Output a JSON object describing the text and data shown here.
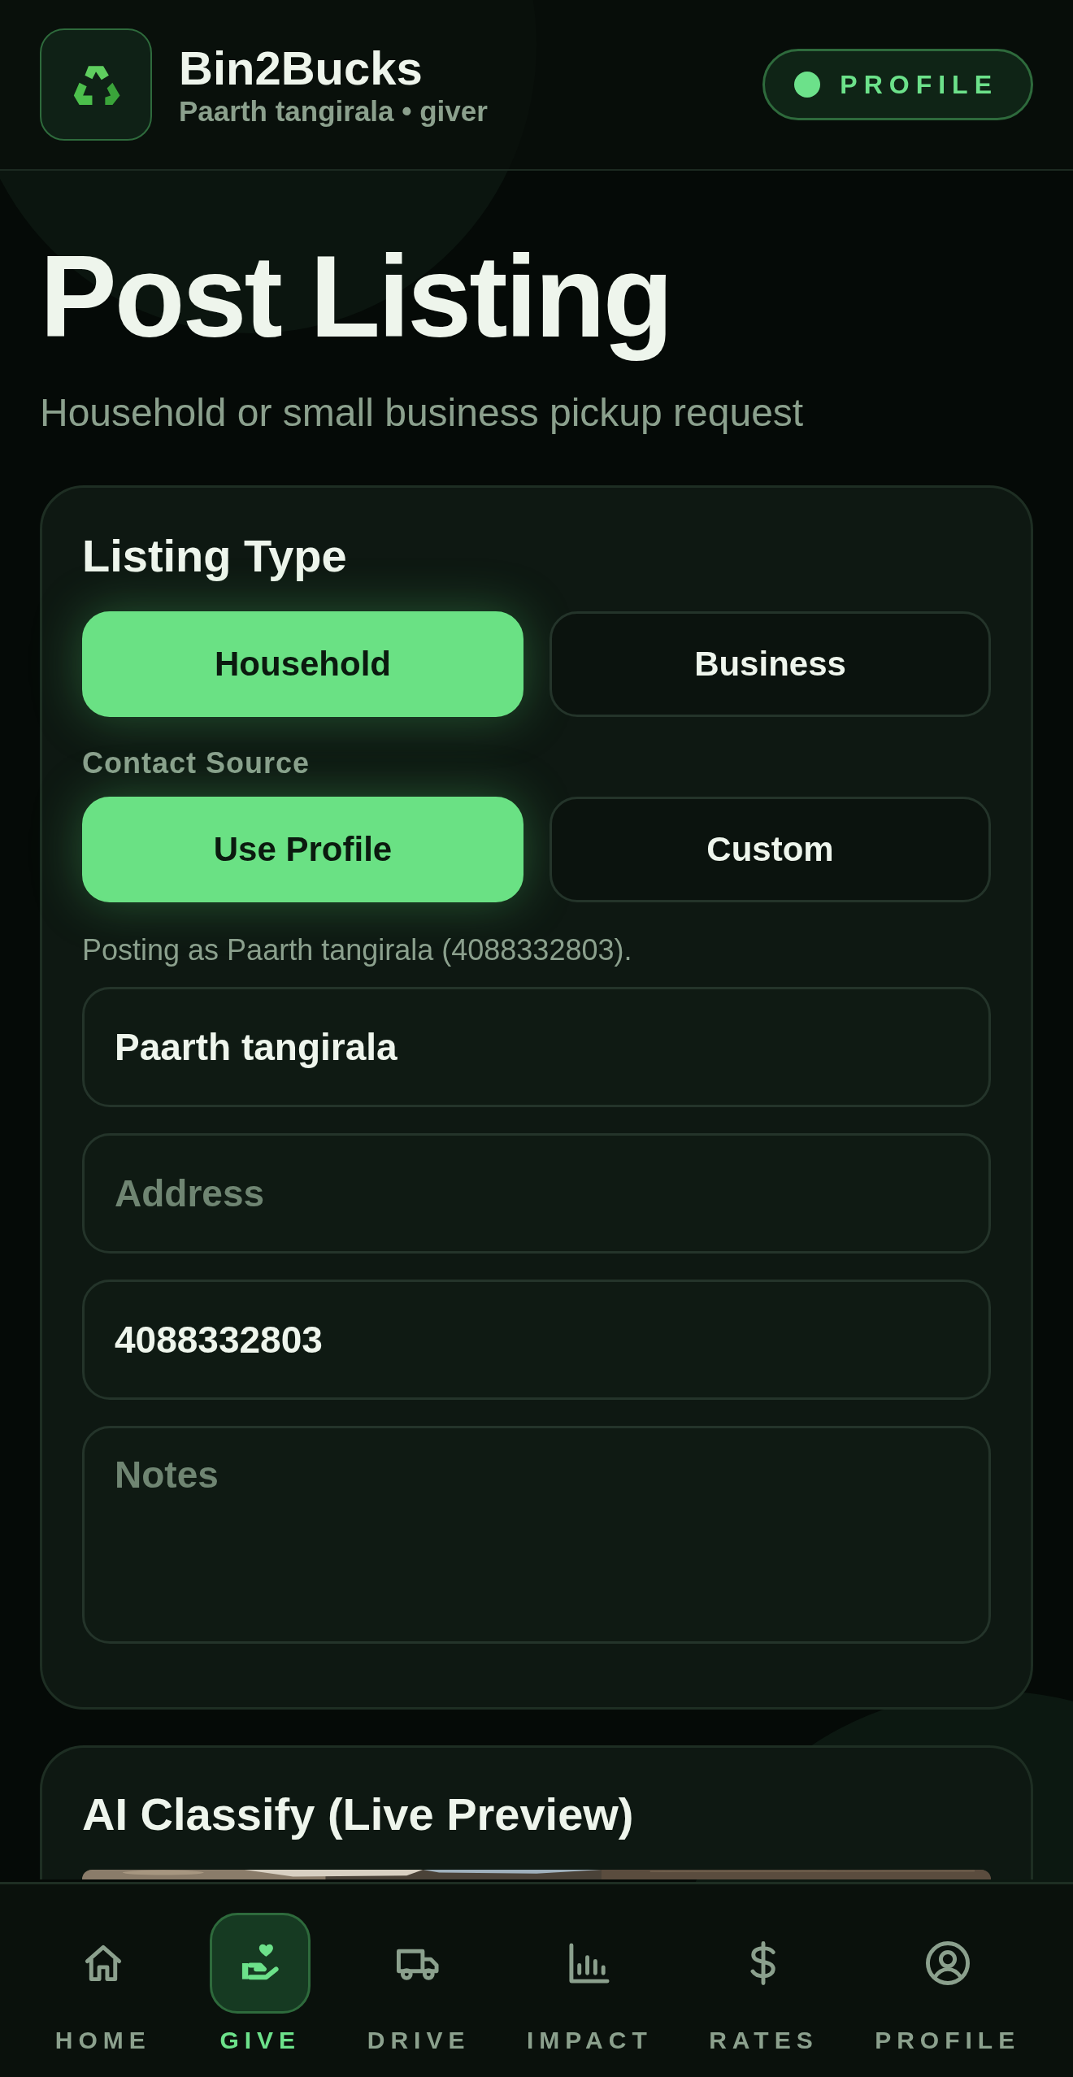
{
  "header": {
    "app_name": "Bin2Bucks",
    "subtitle": "Paarth tangirala • giver",
    "profile_button": {
      "label": "PROFILE",
      "online": true
    }
  },
  "page": {
    "title": "Post Listing",
    "subtitle": "Household or small business pickup request"
  },
  "listing_card": {
    "title": "Listing Type",
    "listing_types": [
      {
        "label": "Household",
        "selected": true
      },
      {
        "label": "Business",
        "selected": false
      }
    ],
    "contact_source_label": "Contact Source",
    "contact_sources": [
      {
        "label": "Use Profile",
        "selected": true
      },
      {
        "label": "Custom",
        "selected": false
      }
    ],
    "posting_note": "Posting as Paarth tangirala (4088332803).",
    "fields": [
      {
        "kind": "input",
        "value": "Paarth tangirala"
      },
      {
        "kind": "input",
        "placeholder": "Address"
      },
      {
        "kind": "input",
        "value": "4088332803"
      },
      {
        "kind": "textarea",
        "placeholder": "Notes"
      }
    ]
  },
  "classify_card": {
    "title": "AI Classify (Live Preview)"
  },
  "bottom_nav": [
    {
      "label": "HOME",
      "selected": false
    },
    {
      "label": "GIVE",
      "selected": true
    },
    {
      "label": "DRIVE",
      "selected": false
    },
    {
      "label": "IMPACT",
      "selected": false
    },
    {
      "label": "RATES",
      "selected": false
    },
    {
      "label": "PROFILE",
      "selected": false
    }
  ]
}
